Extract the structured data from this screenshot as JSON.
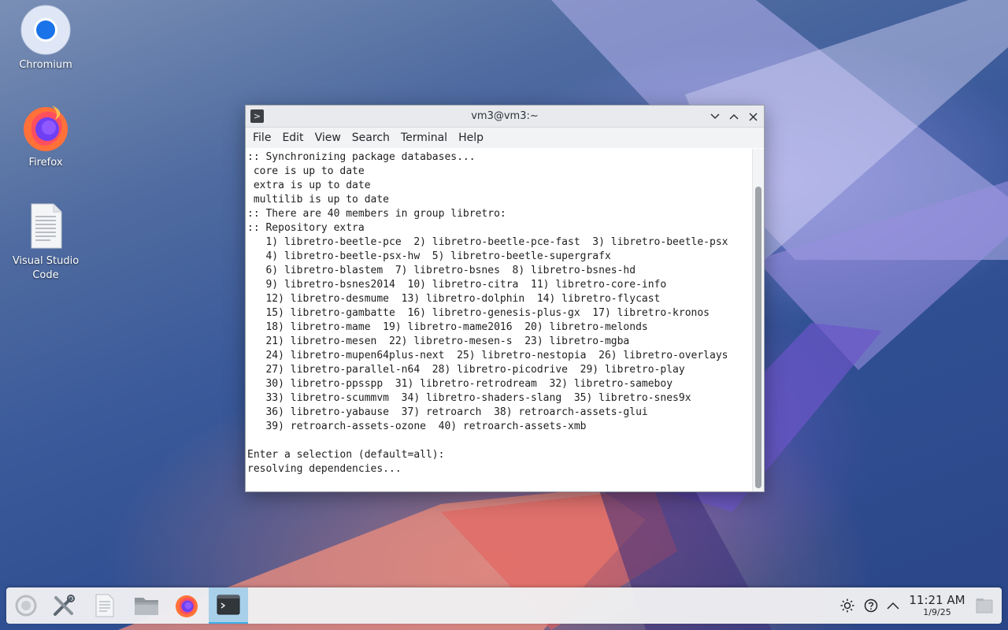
{
  "desktop": {
    "icons": [
      {
        "label": "Chromium",
        "icon": "chromium-icon"
      },
      {
        "label": "Firefox",
        "icon": "firefox-icon"
      },
      {
        "label": "Visual Studio Code",
        "icon": "text-document-icon"
      }
    ]
  },
  "window": {
    "title": "vm3@vm3:~",
    "app_icon": "terminal-icon",
    "menu": [
      "File",
      "Edit",
      "View",
      "Search",
      "Terminal",
      "Help"
    ],
    "terminal_lines": [
      ":: Synchronizing package databases...",
      " core is up to date",
      " extra is up to date",
      " multilib is up to date",
      ":: There are 40 members in group libretro:",
      ":: Repository extra",
      "   1) libretro-beetle-pce  2) libretro-beetle-pce-fast  3) libretro-beetle-psx",
      "   4) libretro-beetle-psx-hw  5) libretro-beetle-supergrafx",
      "   6) libretro-blastem  7) libretro-bsnes  8) libretro-bsnes-hd",
      "   9) libretro-bsnes2014  10) libretro-citra  11) libretro-core-info",
      "   12) libretro-desmume  13) libretro-dolphin  14) libretro-flycast",
      "   15) libretro-gambatte  16) libretro-genesis-plus-gx  17) libretro-kronos",
      "   18) libretro-mame  19) libretro-mame2016  20) libretro-melonds",
      "   21) libretro-mesen  22) libretro-mesen-s  23) libretro-mgba",
      "   24) libretro-mupen64plus-next  25) libretro-nestopia  26) libretro-overlays",
      "   27) libretro-parallel-n64  28) libretro-picodrive  29) libretro-play",
      "   30) libretro-ppsspp  31) libretro-retrodream  32) libretro-sameboy",
      "   33) libretro-scummvm  34) libretro-shaders-slang  35) libretro-snes9x",
      "   36) libretro-yabause  37) retroarch  38) retroarch-assets-glui",
      "   39) retroarch-assets-ozone  40) retroarch-assets-xmb",
      "",
      "Enter a selection (default=all):",
      "resolving dependencies..."
    ]
  },
  "taskbar": {
    "launchers": [
      "application-launcher-icon",
      "system-settings-icon",
      "text-editor-icon",
      "file-manager-icon",
      "firefox-icon",
      "terminal-icon"
    ],
    "active_launcher": "terminal-icon",
    "tray_icons": [
      "brightness-icon",
      "help-icon",
      "chevron-up-icon"
    ],
    "clock": {
      "time": "11:21 AM",
      "date": "1/9/25"
    },
    "show_desktop_icon": "show-desktop-icon"
  },
  "colors": {
    "accent": "#3daee9",
    "active_task_bg": "#a9d0ea",
    "terminal_bg": "#ffffff",
    "terminal_fg": "#1e1e1e"
  }
}
